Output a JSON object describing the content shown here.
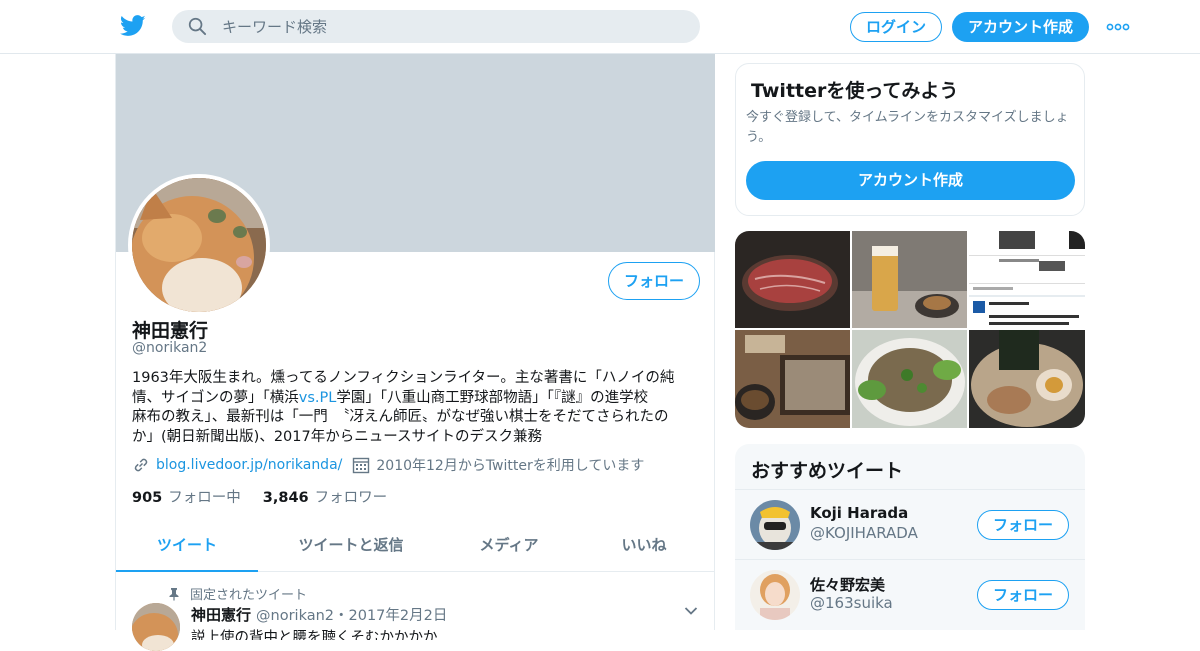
{
  "nav": {
    "search_placeholder": "キーワード検索",
    "login_label": "ログイン",
    "signup_label": "アカウント作成",
    "accent_color": "#1da1f2"
  },
  "profile": {
    "name": "神田憲行",
    "handle": "@norikan2",
    "follow_label": "フォロー",
    "bio_parts": [
      "1963年大阪生まれ。燻ってるノンフィクションライター。主な著書に「ハノイの純",
      "情、サイゴンの夢」「横浜",
      "vs.PL",
      "学園」「八重山商工野球部物語」「『謎』の進学校",
      "麻布の教え」、最新刊は「一門　〝冴えん師匠〟がなぜ強い棋士をそだてさられたの",
      "か」(朝日新聞出版)、2017年からニュースサイトのデスク兼務"
    ],
    "url": "blog.livedoor.jp/norikanda/",
    "joined": "2010年12月からTwitterを利用しています",
    "following_count": "905",
    "following_label": "フォロー中",
    "followers_count": "3,846",
    "followers_label": "フォロワー"
  },
  "tabs": [
    {
      "label": "ツイート",
      "active": true
    },
    {
      "label": "ツイートと返信",
      "active": false
    },
    {
      "label": "メディア",
      "active": false
    },
    {
      "label": "いいね",
      "active": false
    }
  ],
  "pinned_tweet": {
    "pinned_label": "固定されたツイート",
    "author": "神田憲行",
    "meta": "@norikan2・2017年2月2日",
    "text": "説上使の背中と腰を聴くそむかかかか"
  },
  "signup_card": {
    "title": "Twitterを使ってみよう",
    "subtitle": "今すぐ登録して、タイムラインをカスタマイズしましょう。",
    "button_label": "アカウント作成"
  },
  "media": {
    "thumbnails": [
      "steak",
      "beer",
      "app-screenshot",
      "soba",
      "salad",
      "ramen"
    ]
  },
  "recommended": {
    "title": "おすすめツイート",
    "follow_label": "フォロー",
    "users": [
      {
        "name": "Koji Harada",
        "handle": "@KOJIHARADA"
      },
      {
        "name": "佐々野宏美",
        "handle": "@163suika"
      }
    ]
  }
}
